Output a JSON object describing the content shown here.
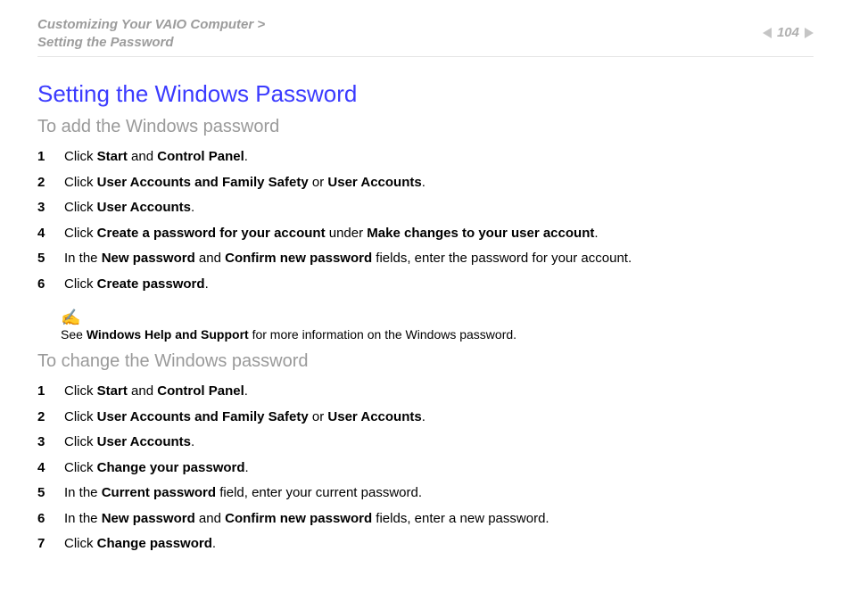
{
  "header": {
    "breadcrumb_line1": "Customizing Your VAIO Computer",
    "breadcrumb_arrow": ">",
    "breadcrumb_line2": "Setting the Password",
    "page_number": "104"
  },
  "title": "Setting the Windows Password",
  "section_add": {
    "heading": "To add the Windows password",
    "steps": [
      {
        "n": "1",
        "pre": "Click ",
        "b1": "Start",
        "mid1": " and ",
        "b2": "Control Panel",
        "tail": "."
      },
      {
        "n": "2",
        "pre": "Click ",
        "b1": "User Accounts and Family Safety",
        "mid1": " or ",
        "b2": "User Accounts",
        "tail": "."
      },
      {
        "n": "3",
        "pre": "Click ",
        "b1": "User Accounts",
        "mid1": "",
        "b2": "",
        "tail": "."
      },
      {
        "n": "4",
        "pre": "Click ",
        "b1": "Create a password for your account",
        "mid1": " under ",
        "b2": "Make changes to your user account",
        "tail": "."
      },
      {
        "n": "5",
        "pre": "In the ",
        "b1": "New password",
        "mid1": " and ",
        "b2": "Confirm new password",
        "tail": " fields, enter the password for your account."
      },
      {
        "n": "6",
        "pre": "Click ",
        "b1": "Create password",
        "mid1": "",
        "b2": "",
        "tail": "."
      }
    ]
  },
  "note": {
    "icon": "✍",
    "pre": "See ",
    "bold": "Windows Help and Support",
    "tail": " for more information on the Windows password."
  },
  "section_change": {
    "heading": "To change the Windows password",
    "steps": [
      {
        "n": "1",
        "pre": "Click ",
        "b1": "Start",
        "mid1": " and ",
        "b2": "Control Panel",
        "tail": "."
      },
      {
        "n": "2",
        "pre": "Click ",
        "b1": "User Accounts and Family Safety",
        "mid1": " or ",
        "b2": "User Accounts",
        "tail": "."
      },
      {
        "n": "3",
        "pre": "Click ",
        "b1": "User Accounts",
        "mid1": "",
        "b2": "",
        "tail": "."
      },
      {
        "n": "4",
        "pre": "Click ",
        "b1": "Change your password",
        "mid1": "",
        "b2": "",
        "tail": "."
      },
      {
        "n": "5",
        "pre": "In the ",
        "b1": "Current password",
        "mid1": "",
        "b2": "",
        "tail": " field, enter your current password."
      },
      {
        "n": "6",
        "pre": "In the ",
        "b1": "New password",
        "mid1": " and ",
        "b2": "Confirm new password",
        "tail": " fields, enter a new password."
      },
      {
        "n": "7",
        "pre": "Click ",
        "b1": "Change password",
        "mid1": "",
        "b2": "",
        "tail": "."
      }
    ]
  }
}
